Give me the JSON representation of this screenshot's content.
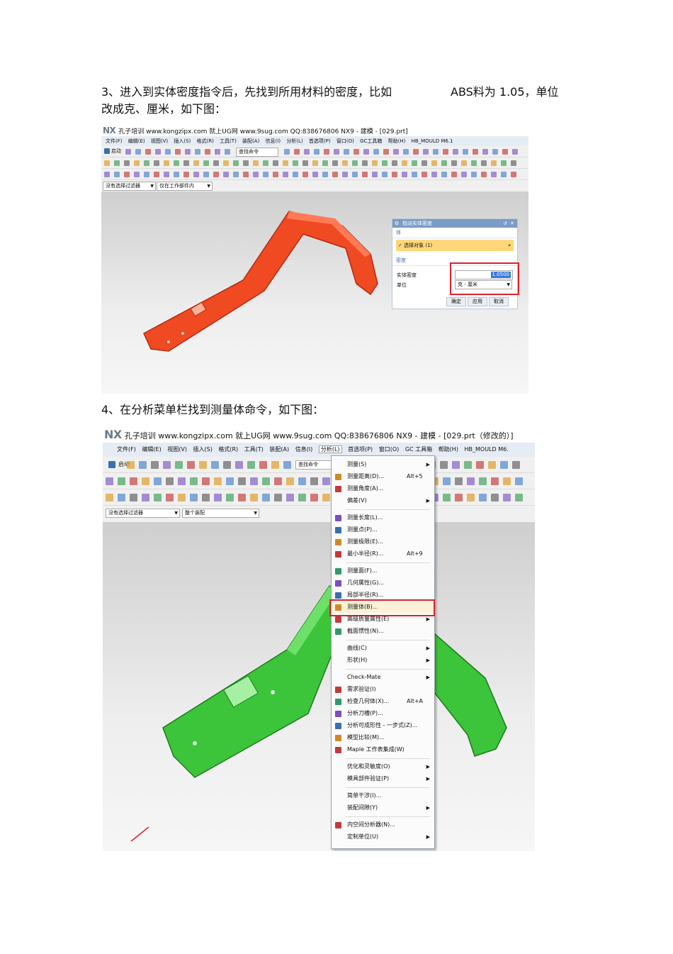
{
  "paragraph3": {
    "line1": "3、进入到实体密度指令后，先找到所用材料的密度，比如",
    "line1_tail": "ABS料为  1.05，单位",
    "line2": "改成克、厘米，如下图："
  },
  "paragraph4": "4、在分析菜单栏找到测量体命令，如下图：",
  "screenshot1": {
    "nx_logo": "NX",
    "window_title": "孔子培训 www.kongzipx.com 就上UG网 www.9sug.com QQ:838676806 NX9 - 建模 - [029.prt]",
    "menu": [
      "文件(F)",
      "编辑(E)",
      "视图(V)",
      "插入(S)",
      "格式(R)",
      "工具(T)",
      "装配(A)",
      "信息(I)",
      "分析(L)",
      "首选项(P)",
      "窗口(O)",
      "GC工具箱",
      "帮助(H)",
      "HB_MOULD M6.1"
    ],
    "start_label": "启动",
    "search_placeholder": "查找命令",
    "filter_combo": "没有选择过滤器",
    "scope_combo": "仅在工作部件内",
    "part_color": "#f04a23",
    "dialog": {
      "title": "指派实体密度",
      "section_body": "体",
      "select_object": "选择对象 (1)",
      "section_density": "密度",
      "density_label": "实体密度",
      "density_value": "1.0500",
      "unit_label": "单位",
      "unit_value": "克 - 厘米",
      "ok": "确定",
      "apply": "应用",
      "cancel": "取消"
    }
  },
  "screenshot2": {
    "nx_logo": "NX",
    "window_title": "孔子培训 www.kongzipx.com 就上UG网 www.9sug.com QQ:838676806 NX9 - 建模 - [029.prt（修改的）]",
    "menu": [
      "文件(F)",
      "编辑(E)",
      "视图(V)",
      "插入(S)",
      "格式(R)",
      "工具(T)",
      "装配(A)",
      "信息(I)",
      "分析(L)",
      "首选项(P)",
      "窗口(O)",
      "GC 工具箱",
      "帮助(H)",
      "HB_MOULD M6."
    ],
    "start_label": "启动",
    "search_placeholder": "查找命令",
    "filter_combo": "没有选择过滤器",
    "scope_combo": "整个装配",
    "part_color": "#3cc43a",
    "analysis_menu": [
      {
        "label": "测量(S)",
        "shortcut": "",
        "sub": true
      },
      {
        "label": "测量距离(D)...",
        "shortcut": "Alt+5",
        "sub": false
      },
      {
        "label": "测量角度(A)...",
        "shortcut": "",
        "sub": false
      },
      {
        "label": "偏差(V)",
        "shortcut": "",
        "sub": true
      },
      {
        "label": "测量长度(L)...",
        "shortcut": "",
        "sub": false
      },
      {
        "label": "测量点(P)...",
        "shortcut": "",
        "sub": false
      },
      {
        "label": "测量极限(E)...",
        "shortcut": "",
        "sub": false
      },
      {
        "label": "最小半径(R)...",
        "shortcut": "Alt+9",
        "sub": false
      },
      {
        "label": "测量面(F)...",
        "shortcut": "",
        "sub": false
      },
      {
        "label": "几何属性(G)...",
        "shortcut": "",
        "sub": false
      },
      {
        "label": "局部半径(R)...",
        "shortcut": "",
        "sub": false
      },
      {
        "label": "测量体(B)...",
        "shortcut": "",
        "sub": false
      },
      {
        "label": "高级质量属性(E)",
        "shortcut": "",
        "sub": true
      },
      {
        "label": "截面惯性(N)...",
        "shortcut": "",
        "sub": false
      },
      {
        "label": "曲线(C)",
        "shortcut": "",
        "sub": true
      },
      {
        "label": "形状(H)",
        "shortcut": "",
        "sub": true
      },
      {
        "label": "Check-Mate",
        "shortcut": "",
        "sub": true
      },
      {
        "label": "需求验证(I)",
        "shortcut": "",
        "sub": false
      },
      {
        "label": "检查几何体(X)...",
        "shortcut": "Alt+A",
        "sub": false
      },
      {
        "label": "分析刀槽(P)...",
        "shortcut": "",
        "sub": false
      },
      {
        "label": "分析可成形性 - 一步式(Z)...",
        "shortcut": "",
        "sub": false
      },
      {
        "label": "模型比较(M)...",
        "shortcut": "",
        "sub": false
      },
      {
        "label": "Maple 工作表集成(W)",
        "shortcut": "",
        "sub": false
      },
      {
        "label": "优化和灵敏度(O)",
        "shortcut": "",
        "sub": true
      },
      {
        "label": "模具部件验证(P)",
        "shortcut": "",
        "sub": true
      },
      {
        "label": "简单干涉(I)...",
        "shortcut": "",
        "sub": false
      },
      {
        "label": "装配间隙(Y)",
        "shortcut": "",
        "sub": true
      },
      {
        "label": "内空间分析器(N)...",
        "shortcut": "",
        "sub": false
      },
      {
        "label": "定制单位(U)",
        "shortcut": "",
        "sub": true
      }
    ]
  },
  "highlight_color": "#d9232e"
}
